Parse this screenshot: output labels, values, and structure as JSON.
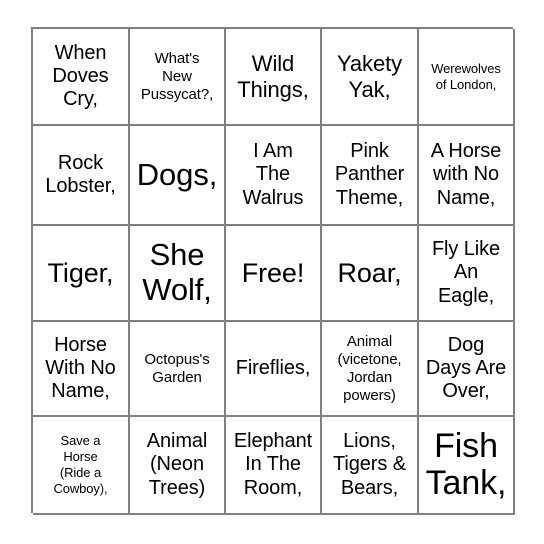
{
  "card": {
    "type": "bingo-card",
    "rows": 5,
    "columns": 5,
    "border_color": "#808080",
    "text_color": "#000000",
    "background_color": "#ffffff",
    "cells": [
      {
        "text": "When\nDoves\nCry,",
        "size": "m"
      },
      {
        "text": "What's\nNew\nPussycat?,",
        "size": "s"
      },
      {
        "text": "Wild\nThings,",
        "size": "ml"
      },
      {
        "text": "Yakety\nYak,",
        "size": "ml"
      },
      {
        "text": "Werewolves\nof London,",
        "size": "xs"
      },
      {
        "text": "Rock\nLobster,",
        "size": "m"
      },
      {
        "text": "Dogs,",
        "size": "xl"
      },
      {
        "text": "I Am\nThe\nWalrus",
        "size": "m"
      },
      {
        "text": "Pink\nPanther\nTheme,",
        "size": "m"
      },
      {
        "text": "A Horse\nwith No\nName,",
        "size": "m"
      },
      {
        "text": "Tiger,",
        "size": "l"
      },
      {
        "text": "She\nWolf,",
        "size": "xl"
      },
      {
        "text": "Free!",
        "size": "l"
      },
      {
        "text": "Roar,",
        "size": "l"
      },
      {
        "text": "Fly Like\nAn\nEagle,",
        "size": "m"
      },
      {
        "text": "Horse\nWith No\nName,",
        "size": "m"
      },
      {
        "text": "Octopus's\nGarden",
        "size": "s"
      },
      {
        "text": "Fireflies,",
        "size": "m"
      },
      {
        "text": "Animal\n(vicetone,\nJordan\npowers)",
        "size": "s"
      },
      {
        "text": "Dog\nDays Are\nOver,",
        "size": "m"
      },
      {
        "text": "Save a\nHorse\n(Ride a\nCowboy),",
        "size": "xs"
      },
      {
        "text": "Animal\n(Neon\nTrees)",
        "size": "m"
      },
      {
        "text": "Elephant\nIn The\nRoom,",
        "size": "m"
      },
      {
        "text": "Lions,\nTigers &\nBears,",
        "size": "m"
      },
      {
        "text": "Fish\nTank,",
        "size": "xxl"
      }
    ]
  }
}
